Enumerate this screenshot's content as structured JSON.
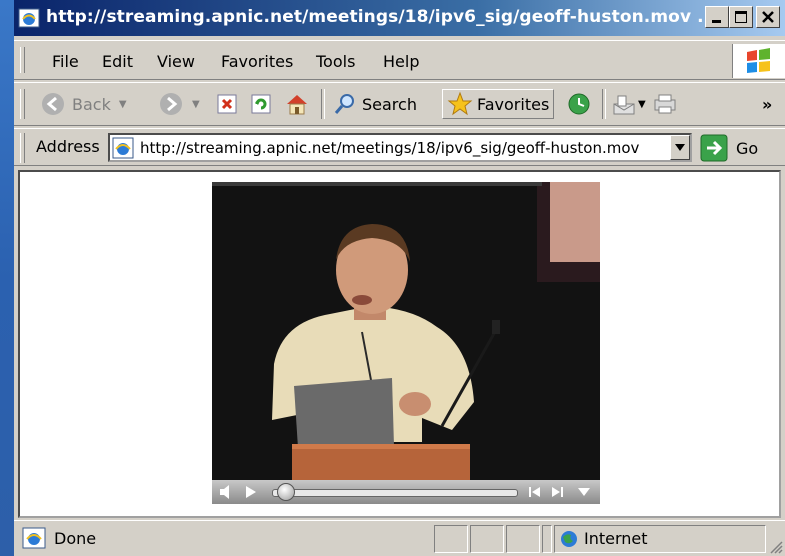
{
  "window": {
    "title": "http://streaming.apnic.net/meetings/18/ipv6_sig/geoff-huston.mov ...",
    "controls": [
      "minimize-icon",
      "maximize-icon",
      "close-icon"
    ]
  },
  "menu": {
    "items": [
      {
        "label": "File"
      },
      {
        "label": "Edit"
      },
      {
        "label": "View"
      },
      {
        "label": "Favorites"
      },
      {
        "label": "Tools"
      },
      {
        "label": "Help"
      }
    ]
  },
  "toolbar": {
    "back_label": "Back",
    "search_label": "Search",
    "favorites_label": "Favorites",
    "overflow": "»"
  },
  "address": {
    "label": "Address",
    "url": "http://streaming.apnic.net/meetings/18/ipv6_sig/geoff-huston.mov",
    "go_label": "Go"
  },
  "player": {
    "progress_fraction": 0.02
  },
  "status": {
    "text": "Done",
    "zone": "Internet"
  },
  "colors": {
    "title_gradient_start": "#0a246a",
    "title_gradient_end": "#a6caf0",
    "desktop": "#2a5ea8",
    "chrome": "#d4d0c8"
  }
}
